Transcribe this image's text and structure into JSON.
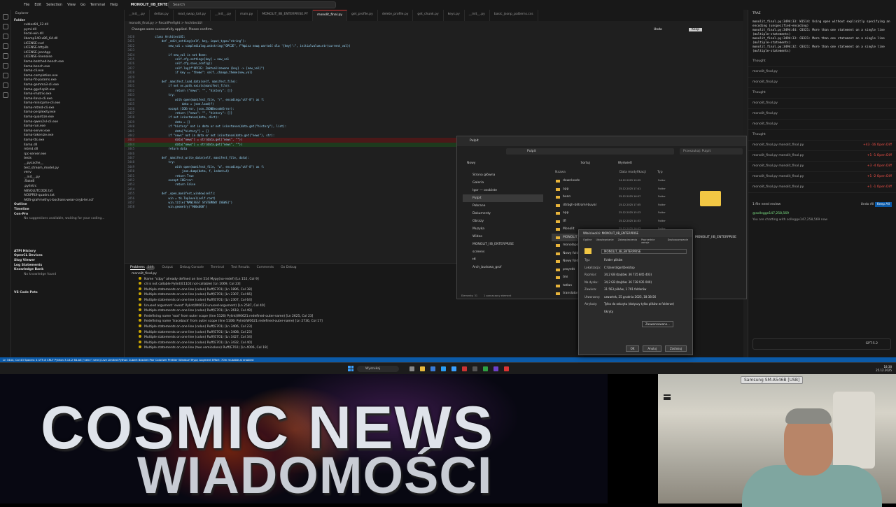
{
  "titlebar": {
    "menu": [
      "File",
      "Edit",
      "Selection",
      "View",
      "Go",
      "Terminal",
      "Help"
    ],
    "search_placeholder": "Search",
    "project": "MONOLIT_IIB_ENTERPRISE"
  },
  "explorer": {
    "title": "Explorer",
    "section_folder": "Folder",
    "files": [
      "cublas64_12.dll",
      "pyml.dll",
      "llocal-win.dll",
      "libomp140.x86_64.dll",
      "LICENSE-curl",
      "LICENSE-httplib",
      "LICENSE-jsonhpp",
      "LICENSE-linenoise",
      "llama-batched-bench.exe",
      "llama-bench.exe",
      "llama-cli.exe",
      "llama-completion.exe",
      "llama-fit-params.exe",
      "llama-gemma3-cli.exe",
      "llama-gguf-split.exe",
      "llama-imatrix.exe",
      "llama-llava-cli.exe",
      "llama-minicpmv-cli.exe",
      "llama-mtmd-cli.exe",
      "llama-perplexity.exe",
      "llama-quantize.exe",
      "llama-qwen2vl-cli.exe",
      "llama-run.exe",
      "llama-server.exe",
      "llama-tokenize.exe",
      "llama-tts.exe",
      "llama.dll",
      "mtmd.dll",
      "rpc-server.exe",
      "tests",
      "__pycache__",
      "test_stream_model.py",
      "venv",
      "__init__.py",
      ".flake8",
      ".pylintrc",
      "ABSOLUTCODE.txt",
      "ACKPRIX-quadrs.txt",
      "AKIS-graf-methyc-bochans-wear-cnyb-ler.scf"
    ],
    "sections": [
      "Outline",
      "Timeline",
      "Con-Pro"
    ],
    "conpro_text": "No suggestions available, waiting for your coding...",
    "bottom_sections": [
      "ATPI History",
      "OpenCL Devices",
      "Slog Viewer",
      "Log Statements",
      "Knowledge Bank"
    ],
    "knowledge_text": "No knowledge found",
    "vs_code_pets": "VS Code Pets"
  },
  "tabs": [
    "__init__.py",
    "deltas.py",
    "read_swap_tail.py",
    "__init__.py",
    "main.py",
    "MONOLIT_IIB_ENTERPRISE.PY",
    "monolit_final.py",
    "get_profile.py",
    "delete_profile.py",
    "get_chunk.py",
    "keys.py",
    "__init__.py",
    "basic_jsonp_patterns.css"
  ],
  "active_tab_index": 6,
  "breadcrumb": "monolit_final.py > RecallPrefight > ArchitectUI",
  "notification": "Changes were successfully applied. Please confirm.",
  "undo_label": "Undo",
  "keep_label": "Keep",
  "code": [
    {
      "n": "3420",
      "t": "        class ArchitectUI:",
      "k": ""
    },
    {
      "n": "3421",
      "t": "            def _edit_setting(self, key, input_type=\"string\"):",
      "k": ""
    },
    {
      "n": "3422",
      "t": "                new_val = simpledialog.askstring(\"OPCJE\", f\"Wpisz nową wartość dla '{key}':\", initialvalue=str(current_val))",
      "k": ""
    },
    {
      "n": "3423",
      "t": "",
      "k": ""
    },
    {
      "n": "3424",
      "t": "                if new_val is not None:",
      "k": ""
    },
    {
      "n": "3425",
      "t": "                    self.cfg.settings[key] = new_val",
      "k": ""
    },
    {
      "n": "3426",
      "t": "                    self.cfg.save_config()",
      "k": ""
    },
    {
      "n": "3427",
      "t": "                    self.log(f\"OPCJE: Zaktualizowano {key} -> {new_val}\")",
      "k": ""
    },
    {
      "n": "3428",
      "t": "                    if key == \"theme\": self._change_theme(new_val)",
      "k": ""
    },
    {
      "n": "3429",
      "t": "",
      "k": ""
    },
    {
      "n": "3430",
      "t": "            def _manifest_load_data(self, manifest_file):",
      "k": ""
    },
    {
      "n": "3431",
      "t": "                if not os.path.exists(manifest_file):",
      "k": ""
    },
    {
      "n": "3432",
      "t": "                    return {\"news\": \"\", \"history\": []}",
      "k": ""
    },
    {
      "n": "3433",
      "t": "                try:",
      "k": ""
    },
    {
      "n": "3434",
      "t": "                    with open(manifest_file, \"r\", encoding=\"utf-8\") as f:",
      "k": ""
    },
    {
      "n": "3435",
      "t": "                        data = json.load(f)",
      "k": ""
    },
    {
      "n": "3436",
      "t": "                except (IOError, json.JSONDecodeError):",
      "k": ""
    },
    {
      "n": "3437",
      "t": "                    return {\"news\": \"\", \"history\": []}",
      "k": ""
    },
    {
      "n": "3438",
      "t": "                if not isinstance(data, dict):",
      "k": ""
    },
    {
      "n": "3439",
      "t": "                    data = {}",
      "k": ""
    },
    {
      "n": "3440",
      "t": "                if \"history\" not in data or not isinstance(data.get(\"history\"), list):",
      "k": ""
    },
    {
      "n": "3441",
      "t": "                    data[\"history\"] = []",
      "k": ""
    },
    {
      "n": "3442",
      "t": "                if \"news\" not in data or not isinstance(data.get(\"news\"), str):",
      "k": ""
    },
    {
      "n": "3443",
      "t": "                    data[\"news\"] = str(data.get(\"news\", \"\"))",
      "k": "del"
    },
    {
      "n": "3444",
      "t": "                    data[\"news\"] = str(data.get(\"news\", \"\"))",
      "k": "add"
    },
    {
      "n": "3445",
      "t": "                return data",
      "k": ""
    },
    {
      "n": "3446",
      "t": "",
      "k": ""
    },
    {
      "n": "3447",
      "t": "            def _manifest_write_data(self, manifest_file, data):",
      "k": ""
    },
    {
      "n": "3448",
      "t": "                try:",
      "k": ""
    },
    {
      "n": "3449",
      "t": "                    with open(manifest_file, \"w\", encoding=\"utf-8\") as f:",
      "k": ""
    },
    {
      "n": "3450",
      "t": "                        json.dump(data, f, indent=4)",
      "k": ""
    },
    {
      "n": "3451",
      "t": "                    return True",
      "k": ""
    },
    {
      "n": "3452",
      "t": "                except IOError:",
      "k": ""
    },
    {
      "n": "3453",
      "t": "                    return False",
      "k": ""
    },
    {
      "n": "3454",
      "t": "",
      "k": ""
    },
    {
      "n": "3455",
      "t": "            def _open_manifest_window(self):",
      "k": ""
    },
    {
      "n": "3456",
      "t": "                win = tk.Toplevel(self.root)",
      "k": ""
    },
    {
      "n": "3457",
      "t": "                win.title(\"MANIFEST SYSTEMOWY [NEWS]\")",
      "k": ""
    },
    {
      "n": "3458",
      "t": "                win.geometry(\"900x600\")",
      "k": ""
    }
  ],
  "panel": {
    "tabs": [
      "Problems",
      "Output",
      "Debug Console",
      "Terminal",
      "Test Results",
      "Comments",
      "Go Debug"
    ],
    "problems_count": "249",
    "file": "monolit_final.py",
    "problems": [
      "Name \"cdpy\" already defined on line 514  Mypy(no-redef)  [Ln 152, Col 9]",
      "cli is not callable  Pylint(E1102:not-callable)  [Ln 1069, Col 23]",
      "Multiple statements on one line (colon)  Ruff(E701)  [Ln 1896, Col 38]",
      "Multiple statements on one line (colon)  Ruff(E701)  [Ln 2307, Col 66]",
      "Multiple statements on one line (colon)  Ruff(E701)  [Ln 2307, Col 64]",
      "Unused argument 'event'  Pylint(W0613:unused-argument)  [Ln 2587, Col 40]",
      "Multiple statements on one line (colon)  Ruff(E701)  [Ln 2618, Col 49]",
      "Redefining name 'root' from outer scope (line 5126)  Pylint(W0621:redefined-outer-name)  [Ln 2625, Col 23]",
      "Redefining name 'traceback' from outer scope (line 5106)  Pylint(W0621:redefined-outer-name)  [Ln 2730, Col 17]",
      "Multiple statements on one line (colon)  Ruff(E701)  [Ln 3406, Col 23]",
      "Multiple statements on one line (colon)  Ruff(E701)  [Ln 3408, Col 23]",
      "Multiple statements on one line (colon)  Ruff(E701)  [Ln 3427, Col 34]",
      "Multiple statements on one line (colon)  Ruff(E701)  [Ln 3432, Col 40]",
      "Multiple statements on one line (two semicolons)  Ruff(E702)  [Ln 4006, Col 19]"
    ]
  },
  "right": {
    "title": "TRAE",
    "output": "monolit_final.py:3494:33: W1514: Using open without explicitly specifying an encoding (unspecified-encoding)\nmonolit_final.py:3494:44: C0321: More than one statement on a single line (multiple-statements)\nmonolit_final.py:3494:33: C0321: More than one statement on a single line (multiple-statements)\nmonolit_final.py:3494:32: C0321: More than one statement on a single line (multiple-statements)",
    "rows": [
      {
        "name": "Thought",
        "stat": ""
      },
      {
        "name": "monolit_final.py",
        "stat": ""
      },
      {
        "name": "monolit_final.py",
        "stat": ""
      },
      {
        "name": "Thought",
        "stat": ""
      },
      {
        "name": "monolit_final.py",
        "stat": ""
      },
      {
        "name": "monolit_final.py",
        "stat": ""
      },
      {
        "name": "monolit_final.py",
        "stat": ""
      },
      {
        "name": "Thought",
        "stat": ""
      },
      {
        "name": "monolit_final.py  monolit_final.py",
        "stat": "+43 -16  Open Diff"
      },
      {
        "name": "monolit_final.py  monolit_final.py",
        "stat": "+1 -1  Open Diff"
      },
      {
        "name": "monolit_final.py  monolit_final.py",
        "stat": "+3 -4  Open Diff"
      },
      {
        "name": "monolit_final.py  monolit_final.py",
        "stat": "+1 -2  Open Diff"
      },
      {
        "name": "monolit_final.py  monolit_final.py",
        "stat": "+1 -1  Open Diff"
      }
    ],
    "files_review": "1 file need review",
    "undo_all": "Undo All",
    "keep_all": "Keep All",
    "account": "@sollegge147,258,569",
    "chat_note": "You are chatting with sollegge147,258,569 now",
    "model": "GPT-5.2"
  },
  "statusbar": "Ln 3444, Col 43  Spaces: 4  UTF-8  CRLF  Python 3.14.2 64-bit ('venv': venv)  Live Limited  Python  Cubert  Bracket Pair Colorizer  Prettier  Windsurf  Mypy  Augment  Effort: 70m  mutable.ai enabled",
  "taskbar": {
    "search_placeholder": "Wyszukaj",
    "time": "18:38",
    "date": "25.12.2025"
  },
  "dialog": {
    "title": "Pulpit",
    "address": "Pulpit",
    "search_placeholder": "Przeszukaj: Pulpit",
    "toolbar": [
      "Nowy",
      "Sortuj",
      "Wyświetl"
    ],
    "nav": [
      "Strona główna",
      "Galeria",
      "Igor — osobiste",
      "Pulpit",
      "Pobrane",
      "Dokumenty",
      "Obrazy",
      "Muzyka",
      "Wideo",
      "MONOLIT_IIB_ENTERPRISE",
      "screens",
      "tfl",
      "Arch_budowa_grof"
    ],
    "nav_selected": 3,
    "columns": [
      "Nazwa",
      "Data modyfikacji",
      "Typ"
    ],
    "files": [
      {
        "name": "downloads",
        "date": "24.12.2025 10:59",
        "type": "Folder"
      },
      {
        "name": "app",
        "date": "25.12.2025 17:41",
        "type": "Folder"
      },
      {
        "name": "bean",
        "date": "25.12.2025 16:57",
        "type": "Folder"
      },
      {
        "name": "dtrbgh-blitroml-buval",
        "date": "25.12.2025 17:05",
        "type": "Folder"
      },
      {
        "name": "app",
        "date": "25.12.2025 15:23",
        "type": "Folder"
      },
      {
        "name": "tfl",
        "date": "25.12.2025 14:33",
        "type": "Folder"
      },
      {
        "name": "Monolit",
        "date": "25.12.2025 16:53",
        "type": "Folder"
      },
      {
        "name": "MONOLIT_IIB_ENTERPRISE",
        "date": "25.12.2025 18:38",
        "type": "Folder"
      },
      {
        "name": "monolapse",
        "date": "",
        "type": ""
      },
      {
        "name": "Nowy folder (2)",
        "date": "",
        "type": ""
      },
      {
        "name": "Nowy folder",
        "date": "",
        "type": ""
      },
      {
        "name": "proyekt",
        "date": "",
        "type": ""
      },
      {
        "name": "tmi",
        "date": "",
        "type": ""
      },
      {
        "name": "totlan",
        "date": "",
        "type": ""
      },
      {
        "name": "translator",
        "date": "",
        "type": ""
      }
    ],
    "preview_name": "MONOLIT_IIB_ENTERPRISE",
    "status_left": "Elementy: 31",
    "status_sel": "1 zaznaczony element"
  },
  "props": {
    "title": "Właściwości: MONOLIT_IIB_ENTERPRISE",
    "tabs": [
      "Ogólne",
      "Udostępnianie",
      "Zabezpieczenia",
      "Poprzednie wersje",
      "Dostosowywanie"
    ],
    "name": "MONOLIT_IIB_ENTERPRISE",
    "rows": [
      {
        "k": "Typ:",
        "v": "Folder plików"
      },
      {
        "k": "Lokalizacja:",
        "v": "C:\\Users\\Igor\\Desktop"
      },
      {
        "k": "Rozmiar:",
        "v": "34,2 GB (bajtów: 36 735 845 403)"
      },
      {
        "k": "Na dysku:",
        "v": "34,2 GB (bajtów: 36 738 935 040)"
      },
      {
        "k": "Zawiera:",
        "v": "31 563 plików, 1 701 folderów"
      },
      {
        "k": "Utworzony:",
        "v": "czwartek, 25 grudnia 2025, 18:38:56"
      },
      {
        "k": "Atrybuty:",
        "v": "Tylko do odczytu (dotyczy tylko plików w folderze)"
      },
      {
        "k": "",
        "v": "Ukryty"
      }
    ],
    "advanced": "Zaawansowane...",
    "ok": "OK",
    "cancel": "Anuluj",
    "apply": "Zastosuj"
  },
  "banner": {
    "line1": "COSMIC NEWS",
    "line2": "WIADOMOŚCI"
  },
  "camera": {
    "label": "Samsung SM-A546B [USB]"
  }
}
